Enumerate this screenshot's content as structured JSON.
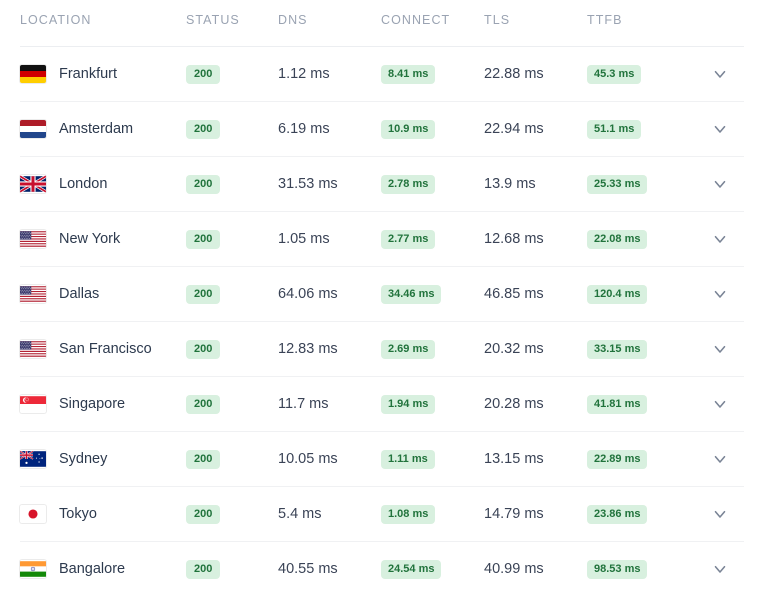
{
  "table": {
    "columns": [
      {
        "key": "location",
        "label": "LOCATION"
      },
      {
        "key": "status",
        "label": "STATUS"
      },
      {
        "key": "dns",
        "label": "DNS"
      },
      {
        "key": "connect",
        "label": "CONNECT"
      },
      {
        "key": "tls",
        "label": "TLS"
      },
      {
        "key": "ttfb",
        "label": "TTFB"
      },
      {
        "key": "expand",
        "label": ""
      }
    ],
    "colors": {
      "header_text": "#9aa3b2",
      "badge_bg": "#d8f0df",
      "badge_text": "#21733c",
      "value_text": "#3a4356",
      "row_divider": "#f0f1f3",
      "chevron": "#7a8496"
    },
    "expand_icon": "chevron-down-icon",
    "rows": [
      {
        "location": "Frankfurt",
        "flag": "flag-de",
        "status": "200",
        "dns": "1.12 ms",
        "connect": "8.41 ms",
        "tls": "22.88 ms",
        "ttfb": "45.3 ms"
      },
      {
        "location": "Amsterdam",
        "flag": "flag-nl",
        "status": "200",
        "dns": "6.19 ms",
        "connect": "10.9 ms",
        "tls": "22.94 ms",
        "ttfb": "51.1 ms"
      },
      {
        "location": "London",
        "flag": "flag-gb",
        "status": "200",
        "dns": "31.53 ms",
        "connect": "2.78 ms",
        "tls": "13.9 ms",
        "ttfb": "25.33 ms"
      },
      {
        "location": "New York",
        "flag": "flag-us",
        "status": "200",
        "dns": "1.05 ms",
        "connect": "2.77 ms",
        "tls": "12.68 ms",
        "ttfb": "22.08 ms"
      },
      {
        "location": "Dallas",
        "flag": "flag-us",
        "status": "200",
        "dns": "64.06 ms",
        "connect": "34.46 ms",
        "tls": "46.85 ms",
        "ttfb": "120.4 ms"
      },
      {
        "location": "San Francisco",
        "flag": "flag-us",
        "status": "200",
        "dns": "12.83 ms",
        "connect": "2.69 ms",
        "tls": "20.32 ms",
        "ttfb": "33.15 ms"
      },
      {
        "location": "Singapore",
        "flag": "flag-sg",
        "status": "200",
        "dns": "11.7 ms",
        "connect": "1.94 ms",
        "tls": "20.28 ms",
        "ttfb": "41.81 ms"
      },
      {
        "location": "Sydney",
        "flag": "flag-au",
        "status": "200",
        "dns": "10.05 ms",
        "connect": "1.11 ms",
        "tls": "13.15 ms",
        "ttfb": "22.89 ms"
      },
      {
        "location": "Tokyo",
        "flag": "flag-jp",
        "status": "200",
        "dns": "5.4 ms",
        "connect": "1.08 ms",
        "tls": "14.79 ms",
        "ttfb": "23.86 ms"
      },
      {
        "location": "Bangalore",
        "flag": "flag-in",
        "status": "200",
        "dns": "40.55 ms",
        "connect": "24.54 ms",
        "tls": "40.99 ms",
        "ttfb": "98.53 ms"
      }
    ]
  }
}
